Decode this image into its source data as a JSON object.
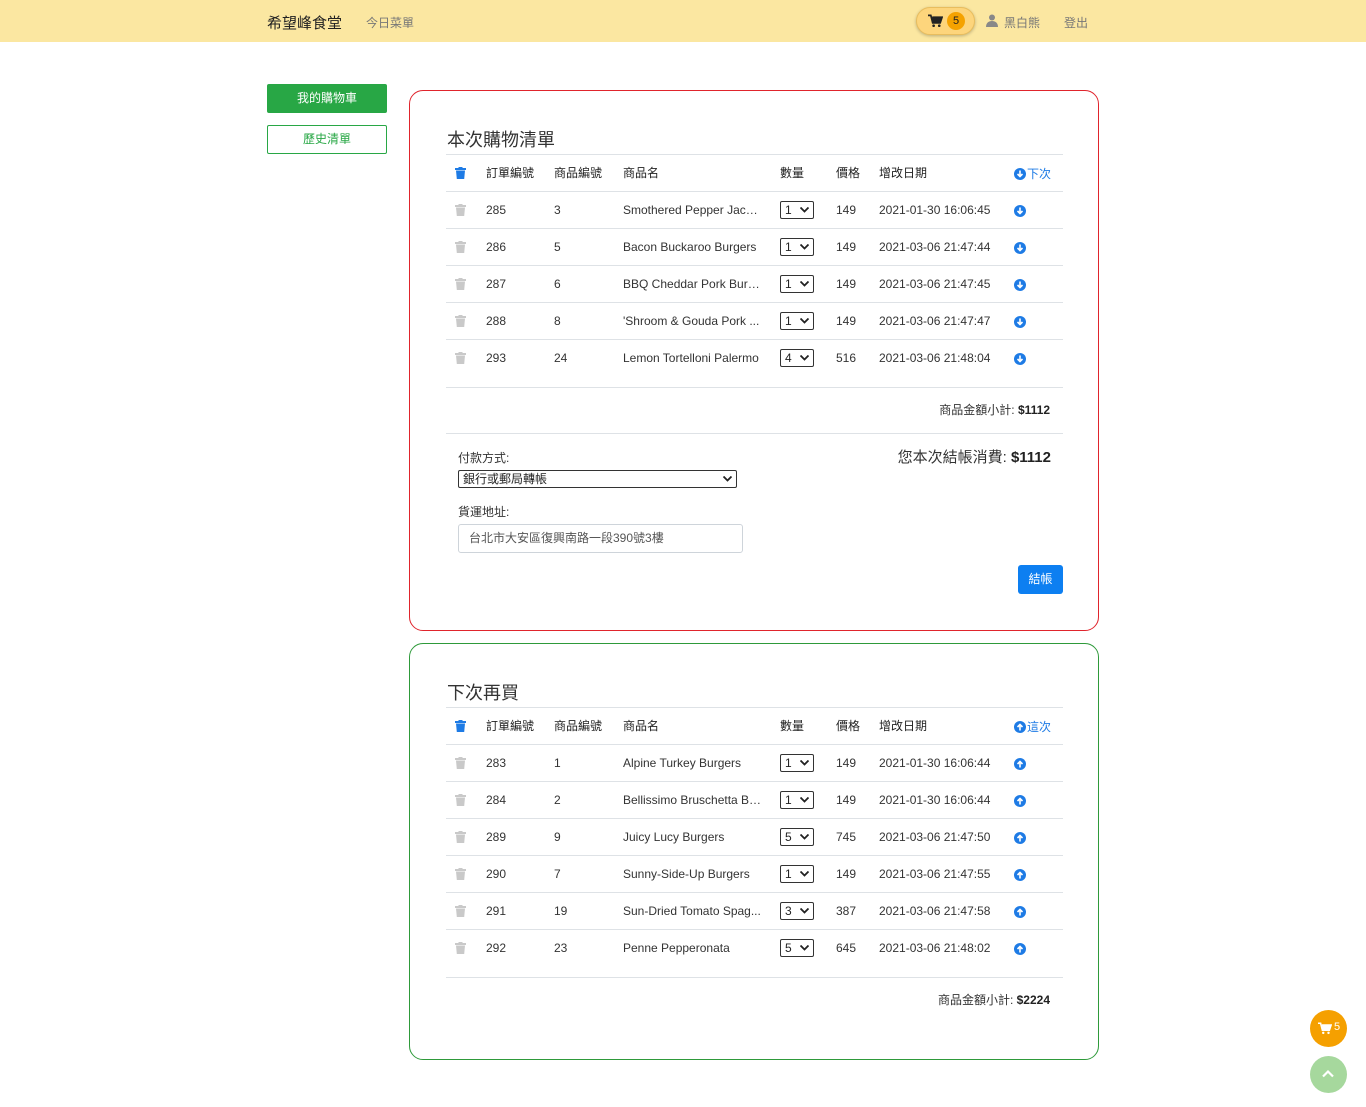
{
  "navbar": {
    "brand": "希望峰食堂",
    "menu_today": "今日菜單",
    "cart_count": "5",
    "user_name": "黑白熊",
    "logout": "登出"
  },
  "sidebar": {
    "my_cart": "我的購物車",
    "history": "歷史清單"
  },
  "columns": {
    "order_id": "訂單編號",
    "product_id": "商品編號",
    "product_name": "商品名",
    "quantity": "數量",
    "price": "價格",
    "date": "增改日期"
  },
  "current": {
    "title": "本次購物清單",
    "action_label": "下次",
    "rows": [
      {
        "order_id": "285",
        "product_id": "3",
        "name": "Smothered Pepper Jack ...",
        "qty": "1",
        "price": "149",
        "date": "2021-01-30 16:06:45"
      },
      {
        "order_id": "286",
        "product_id": "5",
        "name": "Bacon Buckaroo Burgers",
        "qty": "1",
        "price": "149",
        "date": "2021-03-06 21:47:44"
      },
      {
        "order_id": "287",
        "product_id": "6",
        "name": "BBQ Cheddar Pork Burg...",
        "qty": "1",
        "price": "149",
        "date": "2021-03-06 21:47:45"
      },
      {
        "order_id": "288",
        "product_id": "8",
        "name": "'Shroom & Gouda Pork ...",
        "qty": "1",
        "price": "149",
        "date": "2021-03-06 21:47:47"
      },
      {
        "order_id": "293",
        "product_id": "24",
        "name": "Lemon Tortelloni Palermo",
        "qty": "4",
        "price": "516",
        "date": "2021-03-06 21:48:04"
      }
    ],
    "subtotal_label": "商品金額小計:",
    "subtotal_value": "$1112",
    "payment_label": "付款方式:",
    "payment_value": "銀行或郵局轉帳",
    "address_label": "貨運地址:",
    "address_value": "台北市大安區復興南路一段390號3樓",
    "total_label": "您本次結帳消費:",
    "total_value": "$1112",
    "checkout": "結帳"
  },
  "next": {
    "title": "下次再買",
    "action_label": "這次",
    "rows": [
      {
        "order_id": "283",
        "product_id": "1",
        "name": "Alpine Turkey Burgers",
        "qty": "1",
        "price": "149",
        "date": "2021-01-30 16:06:44"
      },
      {
        "order_id": "284",
        "product_id": "2",
        "name": "Bellissimo Bruschetta Bu...",
        "qty": "1",
        "price": "149",
        "date": "2021-01-30 16:06:44"
      },
      {
        "order_id": "289",
        "product_id": "9",
        "name": "Juicy Lucy Burgers",
        "qty": "5",
        "price": "745",
        "date": "2021-03-06 21:47:50"
      },
      {
        "order_id": "290",
        "product_id": "7",
        "name": "Sunny-Side-Up Burgers",
        "qty": "1",
        "price": "149",
        "date": "2021-03-06 21:47:55"
      },
      {
        "order_id": "291",
        "product_id": "19",
        "name": "Sun-Dried Tomato Spag...",
        "qty": "3",
        "price": "387",
        "date": "2021-03-06 21:47:58"
      },
      {
        "order_id": "292",
        "product_id": "23",
        "name": "Penne Pepperonata",
        "qty": "5",
        "price": "645",
        "date": "2021-03-06 21:48:02"
      }
    ],
    "subtotal_label": "商品金額小計:",
    "subtotal_value": "$2224"
  },
  "floating": {
    "cart_count": "5"
  },
  "colors": {
    "navbar": "#fbe7a1",
    "primary_green": "#28a745",
    "current_border": "#e0242c",
    "next_border": "#2e9a3a",
    "accent_blue": "#1e7be5"
  }
}
